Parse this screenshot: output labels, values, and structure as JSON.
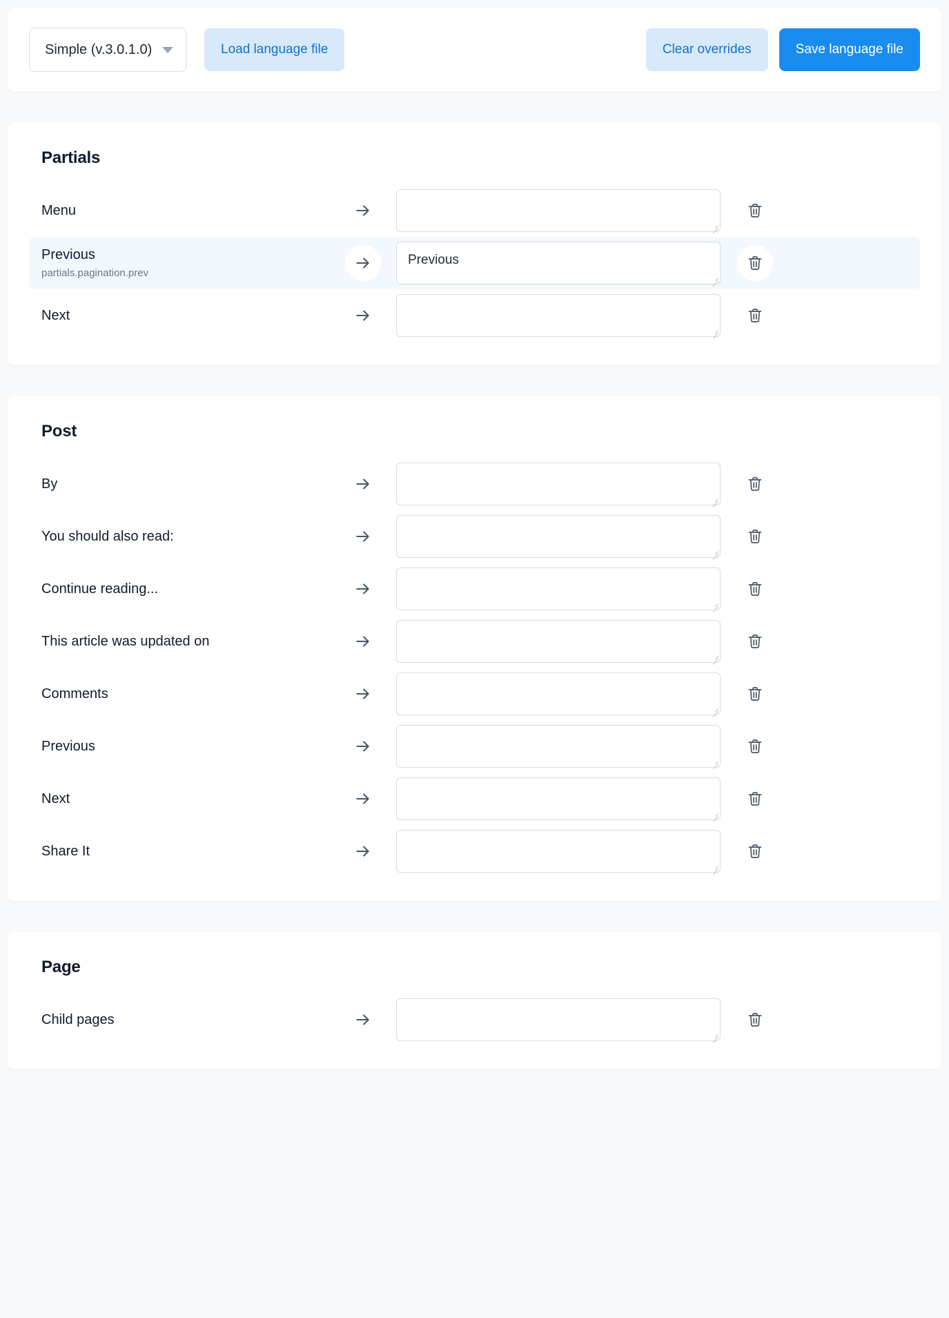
{
  "toolbar": {
    "language_select": {
      "value": "Simple (v.3.0.1.0)",
      "caret_icon": "chevron-down-icon"
    },
    "load_button": "Load language file",
    "clear_button": "Clear overrides",
    "save_button": "Save language file"
  },
  "icons": {
    "arrow": "arrow-right-icon",
    "trash": "trash-icon"
  },
  "colors": {
    "page_background": "#f7f9fb",
    "card_background": "#ffffff",
    "primary_button": "#1a8cf0",
    "soft_button_background": "#d7e9fb",
    "soft_button_text": "#1273c9",
    "highlight_row": "#f2f8fe",
    "heading_text": "#111a2e",
    "subtext": "#6b7585",
    "field_border": "#d7dce2"
  },
  "sections": [
    {
      "title": "Partials",
      "rows": [
        {
          "label": "Menu",
          "sub": "",
          "value": "",
          "highlight": false
        },
        {
          "label": "Previous",
          "sub": "partials.pagination.prev",
          "value": "Previous",
          "highlight": true
        },
        {
          "label": "Next",
          "sub": "",
          "value": "",
          "highlight": false
        }
      ]
    },
    {
      "title": "Post",
      "rows": [
        {
          "label": "By",
          "sub": "",
          "value": "",
          "highlight": false
        },
        {
          "label": "You should also read:",
          "sub": "",
          "value": "",
          "highlight": false
        },
        {
          "label": "Continue reading...",
          "sub": "",
          "value": "",
          "highlight": false
        },
        {
          "label": "This article was updated on",
          "sub": "",
          "value": "",
          "highlight": false
        },
        {
          "label": "Comments",
          "sub": "",
          "value": "",
          "highlight": false
        },
        {
          "label": "Previous",
          "sub": "",
          "value": "",
          "highlight": false
        },
        {
          "label": "Next",
          "sub": "",
          "value": "",
          "highlight": false
        },
        {
          "label": "Share It",
          "sub": "",
          "value": "",
          "highlight": false
        }
      ]
    },
    {
      "title": "Page",
      "rows": [
        {
          "label": "Child pages",
          "sub": "",
          "value": "",
          "highlight": false
        }
      ]
    }
  ]
}
